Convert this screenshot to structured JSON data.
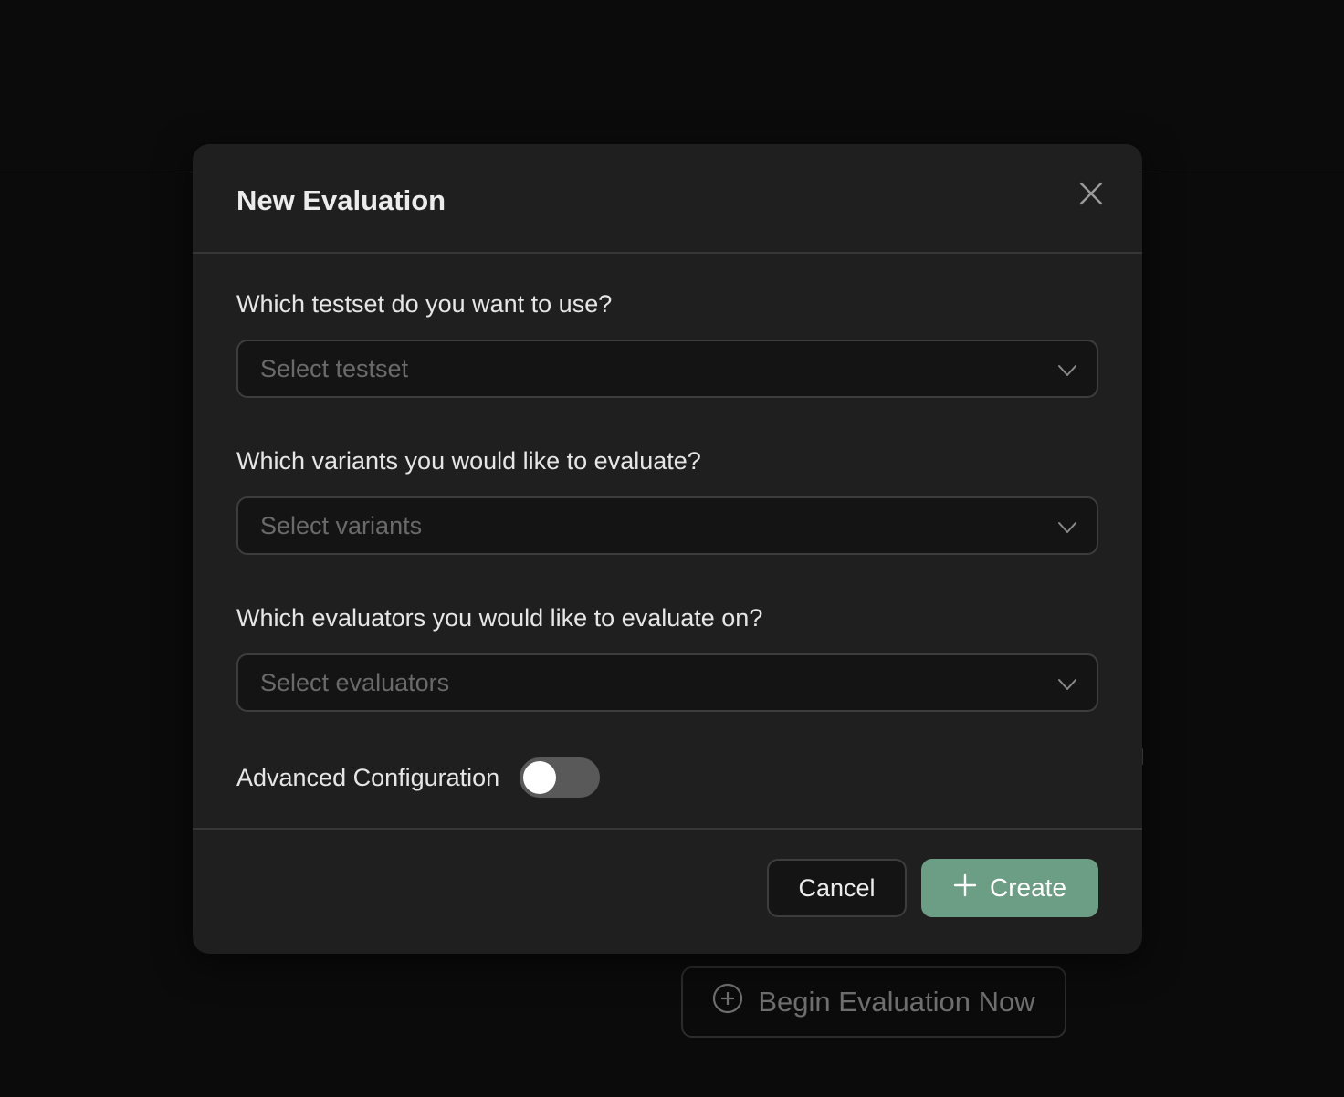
{
  "background": {
    "begin_button_label": "Begin Evaluation Now",
    "begin_button_icon": "plus-circle-icon"
  },
  "modal": {
    "title": "New Evaluation",
    "close_icon": "close-icon",
    "fields": [
      {
        "label": "Which testset do you want to use?",
        "placeholder": "Select testset"
      },
      {
        "label": "Which variants you would like to evaluate?",
        "placeholder": "Select variants"
      },
      {
        "label": "Which evaluators you would like to evaluate on?",
        "placeholder": "Select evaluators"
      }
    ],
    "advanced": {
      "label": "Advanced Configuration",
      "enabled": false
    },
    "footer": {
      "cancel_label": "Cancel",
      "create_label": "Create",
      "create_icon": "plus-icon"
    }
  },
  "colors": {
    "page_bg": "#0b0b0b",
    "modal_bg": "#1f1f1f",
    "input_bg": "#141414",
    "accent": "#6c9e86"
  }
}
